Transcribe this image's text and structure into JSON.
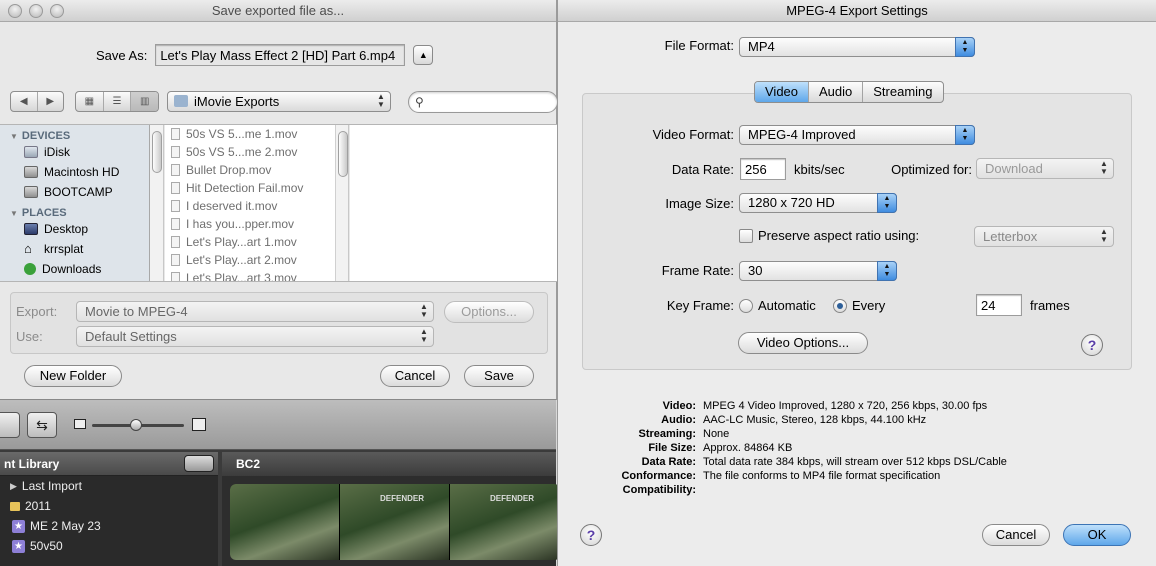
{
  "save_dialog": {
    "title": "Save exported file as...",
    "save_as_label": "Save As:",
    "save_as_value": "Let's Play Mass Effect 2 [HD] Part 6.mp4",
    "location": "iMovie Exports",
    "search_placeholder": "",
    "sidebar": {
      "devices_heading": "DEVICES",
      "devices": [
        "iDisk",
        "Macintosh HD",
        "BOOTCAMP"
      ],
      "places_heading": "PLACES",
      "places": [
        "Desktop",
        "krrsplat",
        "Downloads"
      ]
    },
    "files": [
      "50s VS 5...me 1.mov",
      "50s VS 5...me 2.mov",
      "Bullet Drop.mov",
      "Hit Detection Fail.mov",
      "I deserved it.mov",
      "I has you...pper.mov",
      "Let's Play...art 1.mov",
      "Let's Play...art 2.mov",
      "Let's Play...art 3.mov"
    ],
    "export_label": "Export:",
    "export_value": "Movie to MPEG-4",
    "options_button": "Options...",
    "use_label": "Use:",
    "use_value": "Default Settings",
    "new_folder_button": "New Folder",
    "cancel_button": "Cancel",
    "save_button": "Save"
  },
  "imovie": {
    "library_title": "nt Library",
    "library_items": [
      {
        "label": "Last Import",
        "icon": "disclosure-triangle"
      },
      {
        "label": "2011",
        "icon": "folder-icon"
      },
      {
        "label": "ME 2 May 23",
        "icon": "star-icon"
      },
      {
        "label": "50v50",
        "icon": "star-icon"
      }
    ],
    "event_title": "BC2",
    "thumb_label": "DEFENDER"
  },
  "mpeg_settings": {
    "title": "MPEG-4 Export Settings",
    "file_format_label": "File Format:",
    "file_format_value": "MP4",
    "tabs": [
      "Video",
      "Audio",
      "Streaming"
    ],
    "active_tab": "Video",
    "video_format_label": "Video Format:",
    "video_format_value": "MPEG-4 Improved",
    "data_rate_label": "Data Rate:",
    "data_rate_value": "256",
    "data_rate_unit": "kbits/sec",
    "optimized_for_label": "Optimized for:",
    "optimized_for_value": "Download",
    "image_size_label": "Image Size:",
    "image_size_value": "1280 x 720 HD",
    "preserve_aspect_label": "Preserve aspect ratio using:",
    "preserve_aspect_checked": false,
    "preserve_aspect_value": "Letterbox",
    "frame_rate_label": "Frame Rate:",
    "frame_rate_value": "30",
    "key_frame_label": "Key Frame:",
    "key_frame_automatic": "Automatic",
    "key_frame_every": "Every",
    "key_frame_selected": "Every",
    "key_frame_value": "24",
    "key_frame_unit": "frames",
    "video_options_button": "Video Options...",
    "summary": [
      {
        "key": "Video:",
        "value": "MPEG 4 Video Improved, 1280 x 720, 256 kbps, 30.00 fps"
      },
      {
        "key": "Audio:",
        "value": "AAC-LC Music, Stereo, 128 kbps, 44.100 kHz"
      },
      {
        "key": "Streaming:",
        "value": "None"
      },
      {
        "key": "File Size:",
        "value": "Approx. 84864 KB"
      },
      {
        "key": "Data Rate:",
        "value": "Total data rate 384 kbps, will stream over 512 kbps DSL/Cable"
      },
      {
        "key": "Conformance:",
        "value": "The file conforms to MP4 file format specification"
      },
      {
        "key": "Compatibility:",
        "value": ""
      }
    ],
    "cancel_button": "Cancel",
    "ok_button": "OK",
    "help_symbol": "?"
  },
  "colors": {
    "accent_blue": "#5fa7ea",
    "window_bg": "#ececec",
    "imovie_dark": "#3b3b3b"
  }
}
